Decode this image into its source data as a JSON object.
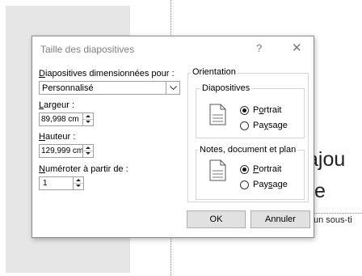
{
  "background": {
    "slide_title_line1": "ajou",
    "slide_title_line2": "e",
    "slide_subtitle": "un sous-ti"
  },
  "dialog": {
    "title": "Taille des diapositives",
    "help": "?",
    "close": "✕",
    "size_for": {
      "label_prefix": "D",
      "label_rest": "iapositives dimensionnées pour :",
      "value": "Personnalisé"
    },
    "width": {
      "label_prefix": "L",
      "label_rest": "argeur :",
      "value": "89,998 cm"
    },
    "height": {
      "label_prefix": "H",
      "label_rest": "auteur :",
      "value": "129,999 cm"
    },
    "number_from": {
      "label_prefix": "N",
      "label_rest": "uméroter à partir de :",
      "value": "1"
    },
    "orientation": {
      "title": "Orientation",
      "slides": {
        "title": "Diapositives",
        "portrait_a": "P",
        "portrait_u": "o",
        "portrait_b": "rtrait",
        "landscape_a": "Pa",
        "landscape_u": "y",
        "landscape_b": "sage",
        "selected": "Portrait"
      },
      "notes": {
        "title": "Notes, document et plan",
        "portrait_u": "P",
        "portrait_b": "ortrait",
        "landscape_a": "Pay",
        "landscape_u": "s",
        "landscape_b": "age",
        "selected": "Portrait"
      }
    },
    "ok_label": "OK",
    "cancel_label": "Annuler"
  },
  "colors": {
    "dialog_border": "#8a8a8a",
    "button_face": "#e1e1e1",
    "side_pane": "#e6e6e6",
    "title_gray": "#808080"
  },
  "icons": [
    "help-icon",
    "close-icon",
    "chevron-down-icon",
    "spin-up-icon",
    "spin-down-icon",
    "page-portrait-icon"
  ]
}
